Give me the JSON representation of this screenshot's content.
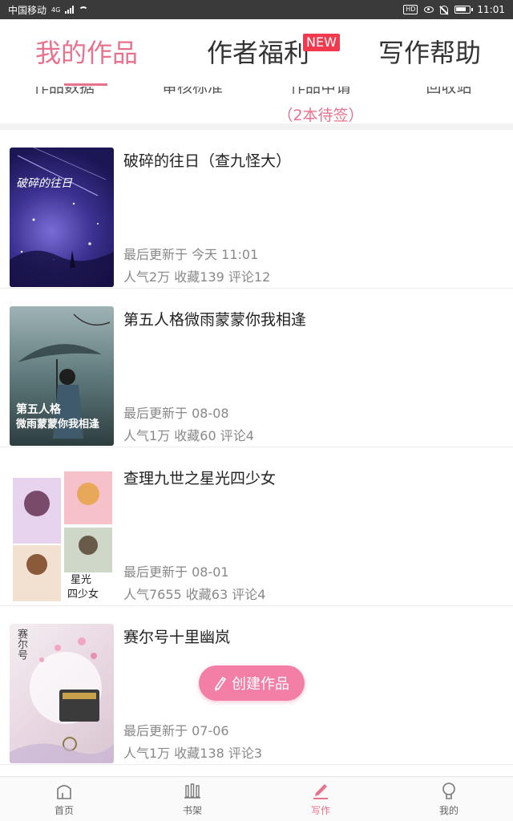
{
  "status_bar": {
    "carrier": "中国移动",
    "net": "4G",
    "hd": "HD",
    "time": "11:01"
  },
  "top_tabs": {
    "mine": "我的作品",
    "benefit": "作者福利",
    "benefit_badge": "NEW",
    "help": "写作帮助"
  },
  "sub_tabs": [
    {
      "label": "作品数据",
      "extra": ""
    },
    {
      "label": "审核标准",
      "extra": ""
    },
    {
      "label": "作品申请",
      "extra": "（2本待签）"
    },
    {
      "label": "回收站",
      "extra": ""
    }
  ],
  "books": [
    {
      "title": "破碎的往日（查九怪大）",
      "cover_text": "破碎的往日",
      "updated": "最后更新于 今天 11:01",
      "stats": "人气2万 收藏139 评论12"
    },
    {
      "title": "第五人格微雨蒙蒙你我相逢",
      "cover_text_1": "第五人格",
      "cover_text_2": "微雨蒙蒙你我相逢",
      "updated": "最后更新于 08-08",
      "stats": "人气1万 收藏60 评论4"
    },
    {
      "title": "查理九世之星光四少女",
      "cover_text_1": "星光",
      "cover_text_2": "四少女",
      "updated": "最后更新于 08-01",
      "stats": "人气7655 收藏63 评论4"
    },
    {
      "title": "赛尔号十里幽岚",
      "cover_text": "赛尔号",
      "updated": "最后更新于 07-06",
      "stats": "人气1万 收藏138 评论3"
    }
  ],
  "create_button": "创建作品",
  "bottom_nav": [
    {
      "label": "首页",
      "icon": "home-icon",
      "active": false
    },
    {
      "label": "书架",
      "icon": "bookshelf-icon",
      "active": false
    },
    {
      "label": "写作",
      "icon": "write-icon",
      "active": true
    },
    {
      "label": "我的",
      "icon": "profile-icon",
      "active": false
    }
  ],
  "colors": {
    "accent": "#e8728e",
    "badge": "#f23a4f",
    "create_button": "#f37fa6"
  }
}
